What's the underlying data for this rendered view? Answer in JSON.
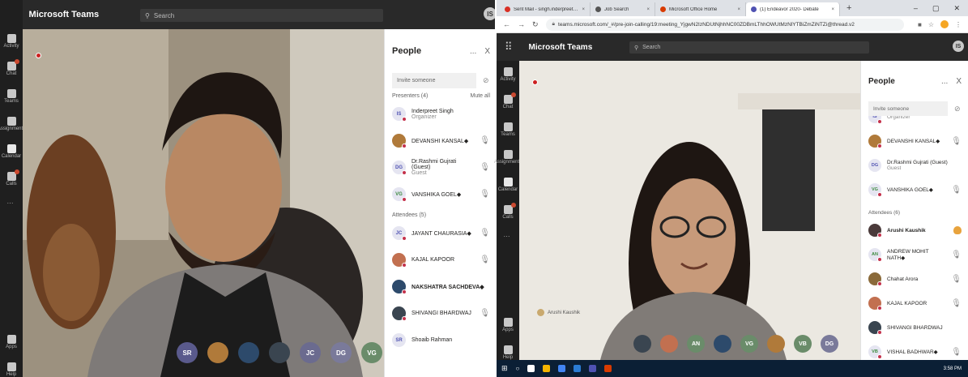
{
  "left": {
    "app_title": "Microsoft Teams",
    "search_placeholder": "Search",
    "me_initials": "IS",
    "rail": [
      "Activity",
      "Chat",
      "Teams",
      "Assignments",
      "Calendar",
      "Calls",
      "...",
      "Apps",
      "Help"
    ],
    "panel": {
      "title": "People",
      "more": "...",
      "close": "X",
      "invite_placeholder": "Invite someone",
      "presenters_label": "Presenters (4)",
      "mute_all": "Mute all",
      "attendees_label": "Attendees (5)",
      "presenters": [
        {
          "initials": "IS",
          "name": "Inderpreet Singh",
          "sub": "Organizer",
          "photo": false,
          "color": "#4f52b2",
          "bold": false,
          "mic": false
        },
        {
          "initials": "DK",
          "name": "DEVANSHI KANSAL◆",
          "sub": "",
          "photo": true,
          "color": "#b07a3a",
          "bold": false,
          "mic": true
        },
        {
          "initials": "DG",
          "name": "Dr.Rashmi Gujrati (Guest)",
          "sub": "Guest",
          "photo": false,
          "color": "#4f52b2",
          "bold": false,
          "mic": true
        },
        {
          "initials": "VG",
          "name": "VANSHIKA GOEL◆",
          "sub": "",
          "photo": false,
          "color": "#3d8b40",
          "bold": false,
          "mic": true
        }
      ],
      "attendees": [
        {
          "initials": "JC",
          "name": "JAYANT CHAURASIA◆",
          "sub": "",
          "photo": false,
          "color": "#4f52b2",
          "bold": false,
          "mic": true
        },
        {
          "initials": "KK",
          "name": "KAJAL KAPOOR",
          "sub": "",
          "photo": true,
          "color": "#c27050",
          "bold": false,
          "mic": true
        },
        {
          "initials": "NS",
          "name": "NAKSHATRA SACHDEVA◆",
          "sub": "",
          "photo": true,
          "color": "#2d4a6b",
          "bold": true,
          "mic": false
        },
        {
          "initials": "SB",
          "name": "SHIVANGI BHARDWAJ",
          "sub": "",
          "photo": true,
          "color": "#3a4550",
          "bold": false,
          "mic": true
        },
        {
          "initials": "SR",
          "name": "Shoaib Rahman",
          "sub": "",
          "photo": false,
          "color": "#4f52b2",
          "bold": false,
          "mic": false
        }
      ]
    },
    "strip": [
      {
        "label": "SR",
        "bg": "#5a5a8c"
      },
      {
        "label": "",
        "bg": "#b07a3a"
      },
      {
        "label": "",
        "bg": "#2d4a6b"
      },
      {
        "label": "",
        "bg": "#3a4550"
      },
      {
        "label": "JC",
        "bg": "#6b6b8f"
      },
      {
        "label": "DG",
        "bg": "#7a7a9a"
      },
      {
        "label": "VG",
        "bg": "#6a8c6a"
      },
      {
        "label": "",
        "bg": "#c27050"
      }
    ]
  },
  "right": {
    "tabs": [
      {
        "title": "Sent Mail - singh.inderpreet650",
        "color": "#d93025",
        "active": false
      },
      {
        "title": "Job Search",
        "color": "#555555",
        "active": false
      },
      {
        "title": "Microsoft Office Home",
        "color": "#d83b01",
        "active": false
      },
      {
        "title": "(1) Endeavor 2020- Debate",
        "color": "#4f52b2",
        "active": true
      }
    ],
    "new_tab": "+",
    "window_controls": [
      "–",
      "▢",
      "✕"
    ],
    "url": "teams.microsoft.com/_#/pre-join-calling/19:meeting_YjgwN2IzNDUtNjhhNC00ZDBmLThhOWUtMzNlYTBiZmZiNTZi@thread.v2",
    "app_title": "Microsoft Teams",
    "search_placeholder": "Search",
    "rail": [
      "Activity",
      "Chat",
      "Teams",
      "Assignments",
      "Calendar",
      "Calls",
      "...",
      "Apps",
      "Help"
    ],
    "self_label": "Arushi Kaushik",
    "panel": {
      "title": "People",
      "more": "...",
      "close": "X",
      "invite_placeholder": "Invite someone",
      "attendees_label": "Attendees (6)",
      "presenters": [
        {
          "initials": "IS",
          "name": "",
          "sub": "Organizer",
          "photo": false,
          "color": "#4f52b2",
          "bold": false,
          "mic": false
        },
        {
          "initials": "DK",
          "name": "DEVANSHI KANSAL◆",
          "sub": "",
          "photo": true,
          "color": "#b07a3a",
          "bold": false,
          "mic": true
        },
        {
          "initials": "DG",
          "name": "Dr.Rashmi Gujrati (Guest)",
          "sub": "Guest",
          "photo": false,
          "color": "#4f52b2",
          "bold": false,
          "mic": false
        },
        {
          "initials": "VG",
          "name": "VANSHIKA GOEL◆",
          "sub": "",
          "photo": false,
          "color": "#3d8b40",
          "bold": false,
          "mic": true
        }
      ],
      "attendees": [
        {
          "initials": "AK",
          "name": "Arushi Kaushik",
          "sub": "",
          "photo": true,
          "color": "#4a3a3a",
          "bold": true,
          "mic": false,
          "hand": true
        },
        {
          "initials": "AN",
          "name": "ANDREW MOHIT NATH◆",
          "sub": "",
          "photo": false,
          "color": "#3d8b40",
          "bold": false,
          "mic": true
        },
        {
          "initials": "CA",
          "name": "Chahat Arora",
          "sub": "",
          "photo": true,
          "color": "#8a6a3a",
          "bold": false,
          "mic": true
        },
        {
          "initials": "KK",
          "name": "KAJAL KAPOOR",
          "sub": "",
          "photo": true,
          "color": "#c27050",
          "bold": false,
          "mic": true
        },
        {
          "initials": "SB",
          "name": "SHIVANGI BHARDWAJ",
          "sub": "",
          "photo": true,
          "color": "#3a4550",
          "bold": false,
          "mic": false
        },
        {
          "initials": "VB",
          "name": "VISHAL BADHWAR◆",
          "sub": "",
          "photo": false,
          "color": "#3d8b40",
          "bold": false,
          "mic": true
        }
      ]
    },
    "strip": [
      {
        "label": "",
        "bg": "#3a4550"
      },
      {
        "label": "",
        "bg": "#c27050"
      },
      {
        "label": "AN",
        "bg": "#6a8c6a"
      },
      {
        "label": "",
        "bg": "#2d4a6b"
      },
      {
        "label": "VG",
        "bg": "#6a8c6a"
      },
      {
        "label": "",
        "bg": "#b07a3a"
      },
      {
        "label": "VB",
        "bg": "#6a8c6a"
      },
      {
        "label": "DG",
        "bg": "#7a7a9a"
      }
    ],
    "tray_time": "3:58 PM"
  }
}
